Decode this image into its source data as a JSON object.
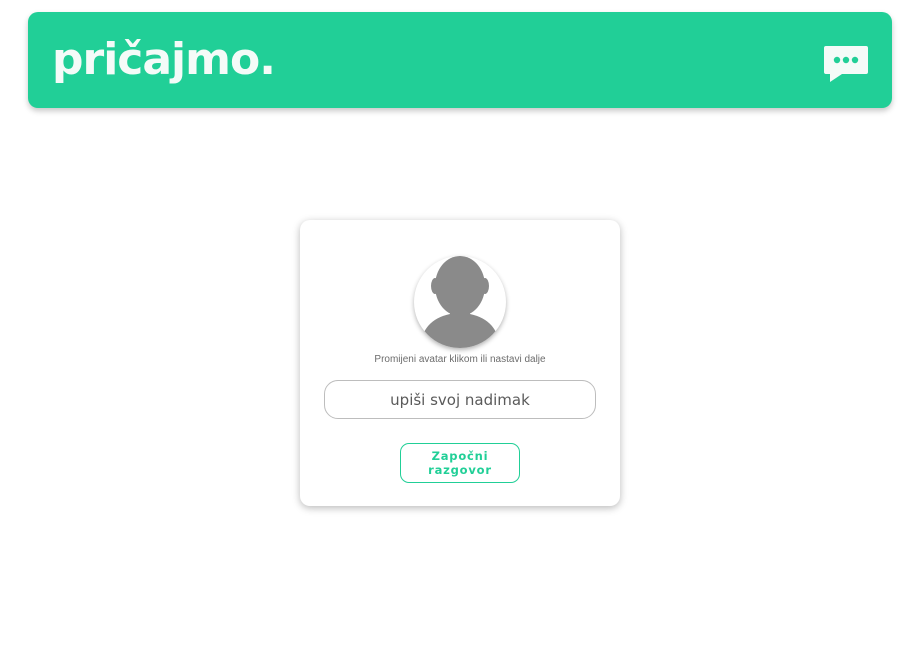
{
  "header": {
    "logo_text": "pričajmo.",
    "chat_icon": "chat-bubble-dots-icon"
  },
  "colors": {
    "brand": "#21cf97",
    "logo_text": "#f4fbf8",
    "avatar_silhouette": "#8a8a8a"
  },
  "login_card": {
    "avatar_icon": "default-user-avatar-icon",
    "hint": "Promijeni avatar klikom ili nastavi dalje",
    "nickname_input": {
      "placeholder": "upiši svoj nadimak",
      "value": ""
    },
    "start_button_label": "Započni razgovor"
  }
}
